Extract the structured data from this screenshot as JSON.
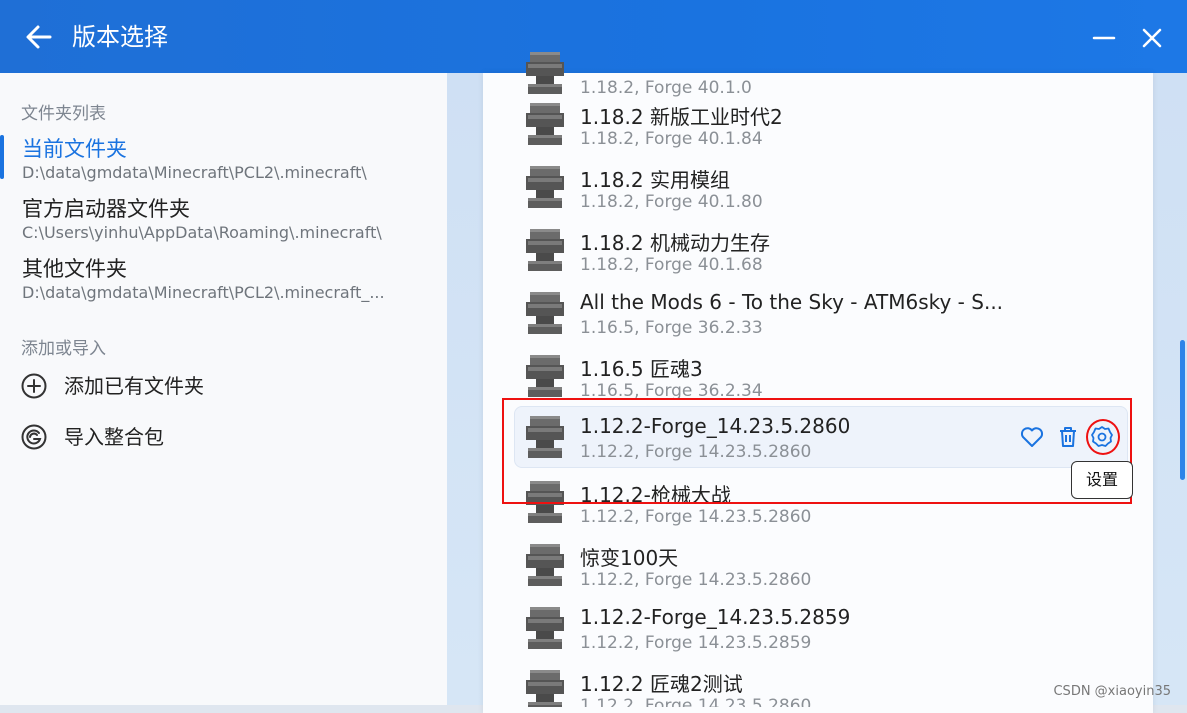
{
  "window": {
    "title": "版本选择"
  },
  "sidebar": {
    "folders_header": "文件夹列表",
    "folders": [
      {
        "name": "当前文件夹",
        "path": "D:\\data\\gmdata\\Minecraft\\PCL2\\.minecraft\\",
        "active": true
      },
      {
        "name": "官方启动器文件夹",
        "path": "C:\\Users\\yinhu\\AppData\\Roaming\\.minecraft\\",
        "active": false
      },
      {
        "name": "其他文件夹",
        "path": "D:\\data\\gmdata\\Minecraft\\PCL2\\.minecraft_...",
        "active": false
      }
    ],
    "add_header": "添加或导入",
    "actions": [
      {
        "label": "添加已有文件夹",
        "icon": "plus-circle-icon"
      },
      {
        "label": "导入整合包",
        "icon": "import-modpack-icon"
      }
    ]
  },
  "versions": [
    {
      "name": "",
      "sub": "1.18.2, Forge 40.1.0"
    },
    {
      "name": "1.18.2 新版工业时代2",
      "sub": "1.18.2, Forge 40.1.84"
    },
    {
      "name": "1.18.2 实用模组",
      "sub": "1.18.2, Forge 40.1.80"
    },
    {
      "name": "1.18.2 机械动力生存",
      "sub": "1.18.2, Forge 40.1.68"
    },
    {
      "name": "All the Mods 6 - To the Sky - ATM6sky - S...",
      "sub": "1.16.5, Forge 36.2.33"
    },
    {
      "name": "1.16.5 匠魂3",
      "sub": "1.16.5, Forge 36.2.34"
    },
    {
      "name": "1.12.2-Forge_14.23.5.2860",
      "sub": "1.12.2, Forge 14.23.5.2860"
    },
    {
      "name": "1.12.2-枪械大战",
      "sub": "1.12.2, Forge 14.23.5.2860"
    },
    {
      "name": "惊变100天",
      "sub": "1.12.2, Forge 14.23.5.2860"
    },
    {
      "name": "1.12.2-Forge_14.23.5.2859",
      "sub": "1.12.2, Forge 14.23.5.2859"
    },
    {
      "name": "1.12.2 匠魂2测试",
      "sub": "1.12.2, Forge 14.23.5.2860"
    }
  ],
  "row_actions": {
    "favorite_icon": "heart-icon",
    "delete_icon": "trash-icon",
    "settings_icon": "gear-icon"
  },
  "tooltip": "设置",
  "watermark": "CSDN @xiaoyin35",
  "colors": {
    "accent": "#1a73e0",
    "highlight": "#e11111"
  }
}
